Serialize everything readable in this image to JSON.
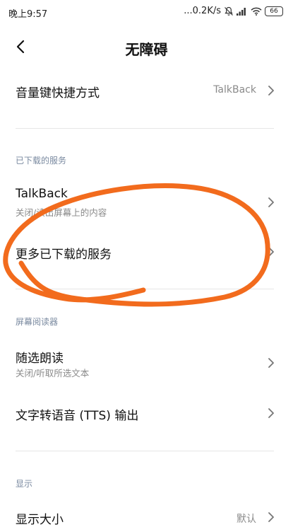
{
  "status_bar": {
    "time": "晚上9:57",
    "network_speed": "...0.2K/s",
    "battery": "66"
  },
  "header": {
    "title": "无障碍"
  },
  "rows": {
    "volume_shortcut": {
      "title": "音量键快捷方式",
      "value": "TalkBack"
    },
    "talkback": {
      "title": "TalkBack",
      "subtitle": "关闭/读出屏幕上的内容"
    },
    "more_downloaded": {
      "title": "更多已下载的服务"
    },
    "select_to_speak": {
      "title": "随选朗读",
      "subtitle": "关闭/听取所选文本"
    },
    "tts_output": {
      "title": "文字转语音 (TTS) 输出"
    },
    "display_size": {
      "title": "显示大小",
      "value": "默认"
    }
  },
  "sections": {
    "downloaded": "已下载的服务",
    "screen_reader": "屏幕阅读器",
    "display": "显示"
  },
  "colors": {
    "annotation": "#f26b1d",
    "section_header": "#7a8aa0"
  }
}
